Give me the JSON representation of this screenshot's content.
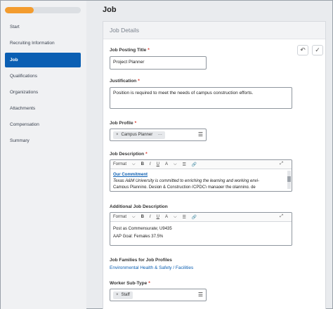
{
  "progress": {
    "fraction": 0.38,
    "color": "#f39c2f"
  },
  "sidebar": {
    "items": [
      {
        "label": "Start"
      },
      {
        "label": "Recruiting Information"
      },
      {
        "label": "Job"
      },
      {
        "label": "Qualifications"
      },
      {
        "label": "Organizations"
      },
      {
        "label": "Attachments"
      },
      {
        "label": "Compensation"
      },
      {
        "label": "Summary"
      }
    ],
    "active": "Job"
  },
  "page": {
    "title": "Job",
    "panel_title": "Job Details"
  },
  "fields": {
    "job_posting_title": {
      "label": "Job Posting Title",
      "value": "Project Planner"
    },
    "justification": {
      "label": "Justification",
      "value": "Position is required to meet the needs of campus construction efforts."
    },
    "job_profile": {
      "label": "Job Profile",
      "pill": "Campus Planner",
      "more": "···"
    },
    "job_description": {
      "label": "Job Description",
      "heading": "Our Commitment",
      "line1": "Texas A&M University is committed to enriching the learning and working envi-",
      "line2": "Campus Planning, Design & Construction (CPDC) manager the planning, de"
    },
    "additional_job_description": {
      "label": "Additional Job Description",
      "line1": "Post as Commensurate; U9435",
      "line2": "AAP Goal: Females 37.5%"
    },
    "job_families": {
      "label": "Job Families for Job Profiles",
      "value": "Environmental Health & Safety / Facilities"
    },
    "worker_sub_type": {
      "label": "Worker Sub-Type",
      "pill": "Staff"
    }
  },
  "toolbar": {
    "format": "Format",
    "bold": "B",
    "italic": "I",
    "underline": "U",
    "font_color": "A",
    "chevron": "⌵",
    "list": "☰",
    "link": "🔗",
    "expand": "⤢"
  },
  "icons": {
    "undo": "↶",
    "check": "✓",
    "remove": "×",
    "list": "☰"
  },
  "required_marker": "*"
}
